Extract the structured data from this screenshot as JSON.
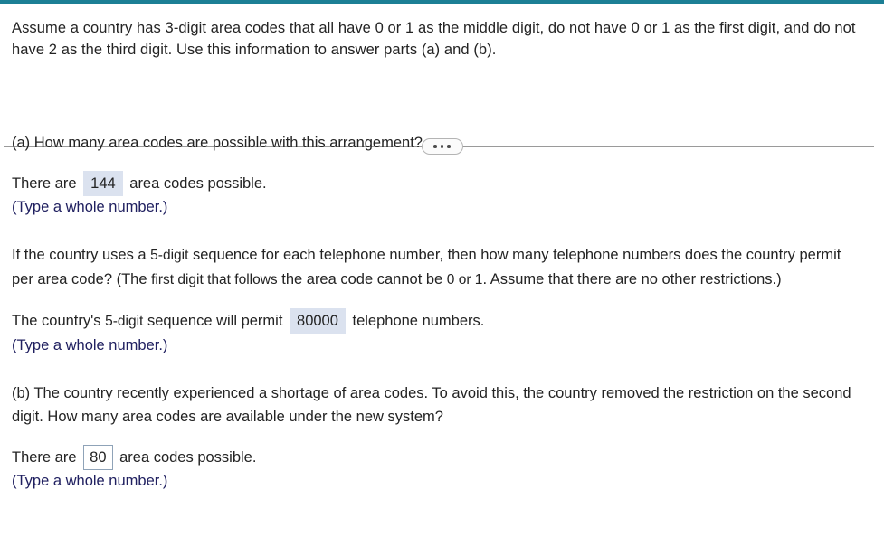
{
  "colors": {
    "accent_bar": "#1c7f95",
    "text": "#232323",
    "hint_text": "#202060",
    "answer_filled_bg": "#dbe2ef",
    "answer_active_border": "#8fa3b8",
    "divider": "#9a9a9a"
  },
  "top_bar": {
    "name": "accent-bar"
  },
  "stem": {
    "text": "Assume a country has 3-digit area codes that all have 0 or 1 as the middle digit, do not have 0 or 1 as the first digit, and do not have 2 as the third digit. Use this information to answer parts (a) and (b)."
  },
  "divider": {
    "expand_button_label": "•••",
    "dot_count": 3
  },
  "parts": [
    {
      "id": "a",
      "question": "(a) How many area codes are possible with this arrangement?",
      "answer_prefix": "There are",
      "answer_value": "144",
      "answer_state": "filled",
      "answer_suffix": "area codes possible.",
      "hint": "(Type a whole number.)"
    },
    {
      "id": "a2",
      "question_part1": "If the country uses a ",
      "question_em1": "5-digit",
      "question_part2": " sequence for each telephone number, then how many telephone numbers does the country permit per area code? (The ",
      "question_em2": "first digit that follows",
      "question_part3": " the area code cannot be ",
      "question_em3": "0 or 1",
      "question_part4": ". Assume that there are no other restrictions.)",
      "answer_prefix": "The country's",
      "answer_prefix_em": "5-digit",
      "answer_prefix_rest": "sequence will permit",
      "answer_value": "80000",
      "answer_state": "filled",
      "answer_suffix": "telephone numbers.",
      "hint": "(Type a whole number.)"
    },
    {
      "id": "b",
      "question": "(b) The country recently experienced a shortage of area codes. To avoid this, the country removed the restriction on the second digit. How many area codes are available under the new system?",
      "answer_prefix": "There are",
      "answer_value": "80",
      "answer_state": "active",
      "answer_suffix": "area codes possible.",
      "hint": "(Type a whole number.)"
    }
  ]
}
